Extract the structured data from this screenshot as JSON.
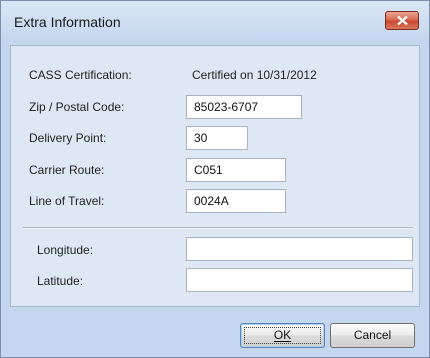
{
  "window": {
    "title": "Extra Information"
  },
  "icons": {
    "close": "close-icon"
  },
  "colors": {
    "close_button": "#d0583f",
    "window_frame": "#c5d7ee",
    "content_panel": "#dee8f5"
  },
  "fields": {
    "cass_label": "CASS Certification:",
    "cass_value": "Certified on 10/31/2012",
    "zip_label": "Zip / Postal Code:",
    "zip_value": "85023-6707",
    "delivery_label": "Delivery Point:",
    "delivery_value": "30",
    "carrier_label": "Carrier Route:",
    "carrier_value": "C051",
    "travel_label": "Line of Travel:",
    "travel_value": "0024A",
    "longitude_label": "Longitude:",
    "longitude_value": "",
    "latitude_label": "Latitude:",
    "latitude_value": ""
  },
  "buttons": {
    "ok": "OK",
    "cancel": "Cancel"
  }
}
